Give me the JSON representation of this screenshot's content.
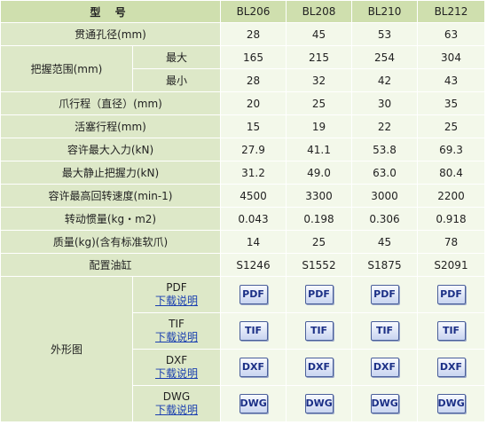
{
  "header": {
    "title": "型 号",
    "models": [
      "BL206",
      "BL208",
      "BL210",
      "BL212"
    ]
  },
  "rows": [
    {
      "label": "贯通孔径(mm)",
      "values": [
        "28",
        "45",
        "53",
        "63"
      ]
    },
    {
      "label": "把握范围(mm)",
      "sub": "最大",
      "values": [
        "165",
        "215",
        "254",
        "304"
      ]
    },
    {
      "sub": "最小",
      "values": [
        "28",
        "32",
        "42",
        "43"
      ]
    },
    {
      "label": "爪行程（直径）(mm)",
      "values": [
        "20",
        "25",
        "30",
        "35"
      ]
    },
    {
      "label": "活塞行程(mm)",
      "values": [
        "15",
        "19",
        "22",
        "25"
      ]
    },
    {
      "label": "容许最大入力(kN)",
      "values": [
        "27.9",
        "41.1",
        "53.8",
        "69.3"
      ]
    },
    {
      "label": "最大静止把握力(kN)",
      "values": [
        "31.2",
        "49.0",
        "63.0",
        "80.4"
      ]
    },
    {
      "label": "容许最高回转速度(min-1)",
      "values": [
        "4500",
        "3300",
        "3000",
        "2200"
      ]
    },
    {
      "label": "转动惯量(kg・m2)",
      "values": [
        "0.043",
        "0.198",
        "0.306",
        "0.918"
      ]
    },
    {
      "label": "质量(kg)(含有标准软爪)",
      "values": [
        "14",
        "25",
        "45",
        "78"
      ]
    },
    {
      "label": "配置油缸",
      "values": [
        "S1246",
        "S1552",
        "S1875",
        "S2091"
      ]
    }
  ],
  "outline": {
    "label": "外形图",
    "link_text": "下载说明",
    "formats": [
      {
        "name": "PDF",
        "badge": "PDF",
        "color": "#1b2f86"
      },
      {
        "name": "TIF",
        "badge": "TIF",
        "color": "#1b2f86"
      },
      {
        "name": "DXF",
        "badge": "DXF",
        "color": "#1b2f86"
      },
      {
        "name": "DWG",
        "badge": "DWG",
        "color": "#1b2f86"
      }
    ]
  },
  "colors": {
    "header_bg": "#cfdfae",
    "label_bg": "#dde8c8",
    "value_bg": "#f3f8ea",
    "link": "#1a3fb0"
  }
}
